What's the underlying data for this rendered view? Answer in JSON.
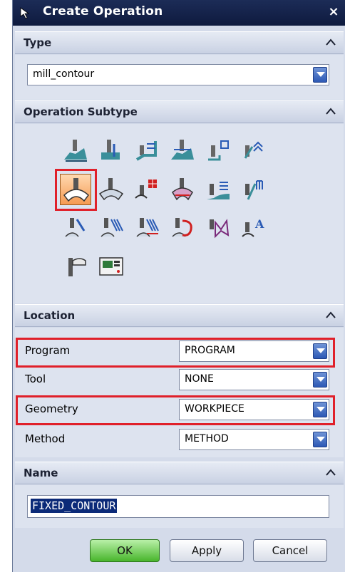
{
  "window": {
    "title": "Create Operation",
    "close_label": "×"
  },
  "type_section": {
    "header": "Type",
    "selected_value": "mill_contour"
  },
  "subtype_section": {
    "header": "Operation Subtype",
    "icons": [
      "cavity-mill-icon",
      "plunge-milling-icon",
      "corner-rough-icon",
      "rest-milling-icon",
      "zlevel-profile-icon",
      "zlevel-corner-icon",
      "fixed-contour-icon",
      "contour-area-icon",
      "contour-surface-area-icon",
      "streamline-icon",
      "contour-area-non-steep-icon",
      "contour-area-dir-steep-icon",
      "flowcut-single-icon",
      "flowcut-multiple-icon",
      "flowcut-ref-tool-icon",
      "flowcut-smooth-icon",
      "solid-profile-3d-icon",
      "contour-text-icon",
      "mill-user-icon",
      "mill-control-icon"
    ],
    "selected_icon": "fixed-contour-icon"
  },
  "location_section": {
    "header": "Location",
    "rows": [
      {
        "label": "Program",
        "value": "PROGRAM"
      },
      {
        "label": "Tool",
        "value": "NONE"
      },
      {
        "label": "Geometry",
        "value": "WORKPIECE"
      },
      {
        "label": "Method",
        "value": "METHOD"
      }
    ]
  },
  "name_section": {
    "header": "Name",
    "value": "FIXED_CONTOUR"
  },
  "buttons": {
    "ok": "OK",
    "apply": "Apply",
    "cancel": "Cancel"
  },
  "colors": {
    "title_bar": "#0e1a3e",
    "highlight": "#e0202a",
    "selected_icon_bg": "#f59a52",
    "ok_button": "#48b52c"
  }
}
